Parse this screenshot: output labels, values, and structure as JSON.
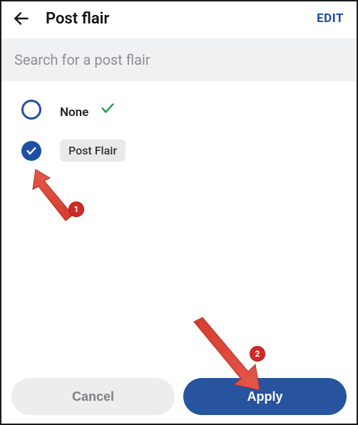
{
  "header": {
    "title": "Post flair",
    "edit_label": "EDIT"
  },
  "search": {
    "placeholder": "Search for a post flair"
  },
  "options": {
    "none_label": "None",
    "flair_label": "Post Flair"
  },
  "footer": {
    "cancel_label": "Cancel",
    "apply_label": "Apply"
  },
  "annotations": {
    "badge1": "1",
    "badge2": "2"
  }
}
